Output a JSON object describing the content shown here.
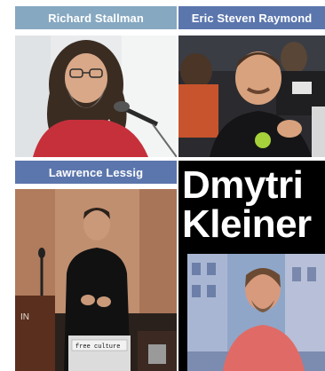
{
  "tiles": [
    {
      "name": "Richard Stallman",
      "header_color": "#86a8c1"
    },
    {
      "name": "Eric Steven Raymond",
      "header_color": "#5b76ad"
    },
    {
      "name": "Lawrence Lessig",
      "header_color": "#5b76ad"
    },
    {
      "name": "Dmytri Kleiner"
    }
  ],
  "poster": {
    "line1": "Dmytri",
    "line2": "Kleiner"
  },
  "photo_text": {
    "laptop_sticker": "free culture"
  }
}
